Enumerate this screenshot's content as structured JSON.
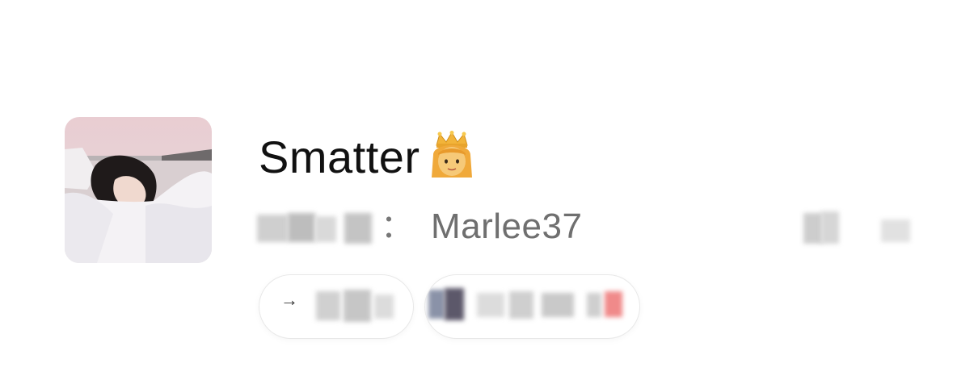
{
  "profile": {
    "name": "Smatter",
    "name_emoji": "princess-with-crown",
    "id_separator": "：",
    "id_value": "Marlee37"
  },
  "avatar": {
    "description": "user-avatar-photo"
  },
  "chips": [
    {
      "icon": "arrow-right-icon",
      "arrow_glyph": "→"
    },
    {
      "icon": "blurred-chip-content"
    }
  ]
}
